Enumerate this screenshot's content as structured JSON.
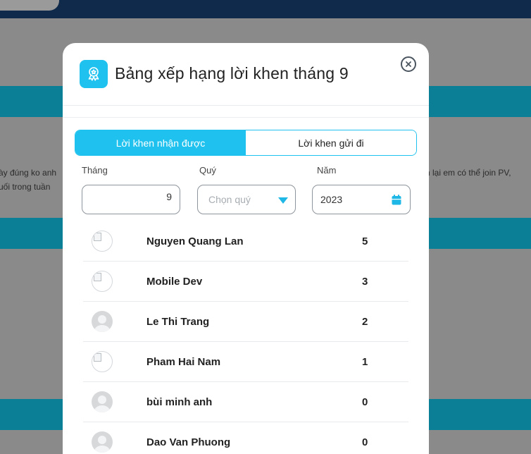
{
  "background": {
    "text_left_1": "ày đúng ko anh",
    "text_left_2": "uối trong tuần",
    "text_right_1": "n lại em có thể join PV,"
  },
  "modal": {
    "title": "Bảng xếp hạng lời khen tháng 9",
    "header_icon": "award-badge-icon",
    "close_icon": "close-icon",
    "tabs": [
      {
        "label": "Lời khen nhận được",
        "active": true
      },
      {
        "label": "Lời khen gửi đi",
        "active": false
      }
    ],
    "filters": {
      "month_label": "Tháng",
      "month_value": "9",
      "quarter_label": "Quý",
      "quarter_placeholder": "Chọn quý",
      "year_label": "Năm",
      "year_value": "2023"
    },
    "ranking": [
      {
        "name": "Nguyen Quang Lan",
        "count": "5",
        "avatar": "broken-image"
      },
      {
        "name": "Mobile Dev",
        "count": "3",
        "avatar": "broken-image"
      },
      {
        "name": "Le Thi Trang",
        "count": "2",
        "avatar": "default-user"
      },
      {
        "name": "Pham Hai Nam",
        "count": "1",
        "avatar": "broken-image"
      },
      {
        "name": "bùi minh anh",
        "count": "0",
        "avatar": "default-user"
      },
      {
        "name": "Dao Van Phuong",
        "count": "0",
        "avatar": "default-user"
      }
    ]
  },
  "colors": {
    "accent": "#1fc2ee",
    "topbar": "#0f2a4a",
    "stripe": "#0b7f95"
  }
}
